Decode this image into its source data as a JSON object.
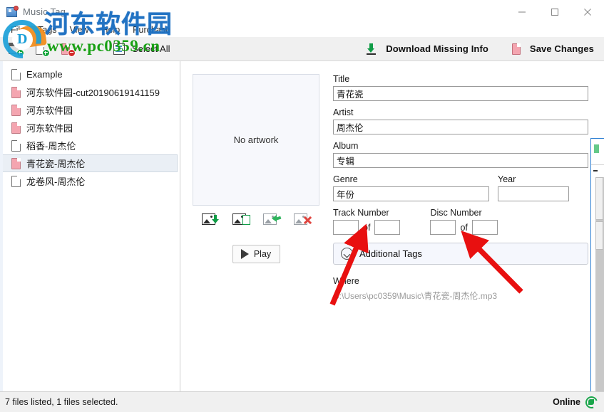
{
  "window": {
    "title": "Music Tag",
    "controls": {
      "minimize": "minimize-button",
      "maximize": "maximize-button",
      "close": "close-button"
    }
  },
  "menu": {
    "items": [
      {
        "label": "File"
      },
      {
        "label": "Tags"
      },
      {
        "label": "View"
      },
      {
        "label": "Help"
      },
      {
        "label": "Purchase"
      }
    ]
  },
  "toolbar": {
    "add_folder_icon": "add-folder-icon",
    "add_file_icon": "add-file-icon",
    "remove_file_icon": "remove-file-icon",
    "select_all_label": "Select All",
    "download_missing_info_label": "Download Missing Info",
    "save_changes_label": "Save Changes"
  },
  "filelist": {
    "items": [
      {
        "name": "Example",
        "icon": "file-white-icon",
        "selected": false
      },
      {
        "name": "河东软件园-cut20190619141159",
        "icon": "file-pink-icon",
        "selected": false
      },
      {
        "name": "河东软件园",
        "icon": "file-pink-icon",
        "selected": false
      },
      {
        "name": "河东软件园",
        "icon": "file-pink-icon",
        "selected": false
      },
      {
        "name": "稻香-周杰伦",
        "icon": "file-white-icon",
        "selected": false
      },
      {
        "name": "青花瓷-周杰伦",
        "icon": "file-pink-icon",
        "selected": true
      },
      {
        "name": "龙卷风-周杰伦",
        "icon": "file-white-icon",
        "selected": false
      }
    ]
  },
  "artwork": {
    "placeholder_text": "No artwork",
    "actions": [
      {
        "name": "artwork-download-icon"
      },
      {
        "name": "artwork-paste-icon"
      },
      {
        "name": "artwork-revert-icon"
      },
      {
        "name": "artwork-delete-icon"
      }
    ],
    "play_label": "Play"
  },
  "form": {
    "title_label": "Title",
    "title_value": "青花瓷",
    "artist_label": "Artist",
    "artist_value": "周杰伦",
    "album_label": "Album",
    "album_value": "专辑",
    "genre_label": "Genre",
    "genre_value": "年份",
    "year_label": "Year",
    "year_value": "",
    "track_number_label": "Track Number",
    "track_number_value": "",
    "track_of_word": "of",
    "track_total_value": "",
    "disc_number_label": "Disc Number",
    "disc_number_value": "",
    "disc_of_word": "of",
    "disc_total_value": "",
    "additional_tags_label": "Additional Tags",
    "where_label": "Where",
    "where_path": "C:\\Users\\pc0359\\Music\\青花瓷-周杰伦.mp3"
  },
  "statusbar": {
    "files_text": "7 files listed, 1 files selected.",
    "connection_label": "Online"
  },
  "watermark": {
    "site_cn": "河东软件园",
    "site_url": "www.pc0359.cn",
    "logo_letter": "D"
  },
  "colors": {
    "accent_blue": "#2d7fd3",
    "green": "#1aa64b",
    "pink_file": "#f4a5b0",
    "arrow_red": "#e81010",
    "selection": "#eaeff5"
  }
}
